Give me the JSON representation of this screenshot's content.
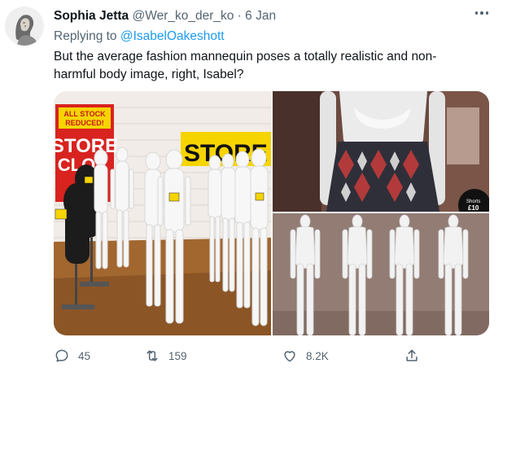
{
  "tweet": {
    "author_name": "Sophia Jetta",
    "author_handle": "@Wer_ko_der_ko",
    "separator": "·",
    "date": "6 Jan",
    "reply_prefix": "Replying to",
    "reply_mention": "@IsabelOakeshott",
    "body": "But the average fashion mannequin poses a totally realistic and non-harmful body image, right, Isabel?"
  },
  "media": {
    "photo1": {
      "sign_all_stock": "ALL STOCK",
      "sign_reduced": "REDUCED!",
      "sign_store": "STORE",
      "sign_clo": "CLO",
      "banner_store": "STORE C"
    },
    "photo2": {
      "tag_shorts": "Shorts",
      "tag_price": "£10"
    },
    "photo3": {}
  },
  "actions": {
    "replies": "45",
    "retweets": "159",
    "likes": "8.2K"
  },
  "icons": {
    "reply": "reply-icon",
    "retweet": "retweet-icon",
    "like": "heart-icon",
    "share": "share-icon",
    "more": "more-icon"
  }
}
